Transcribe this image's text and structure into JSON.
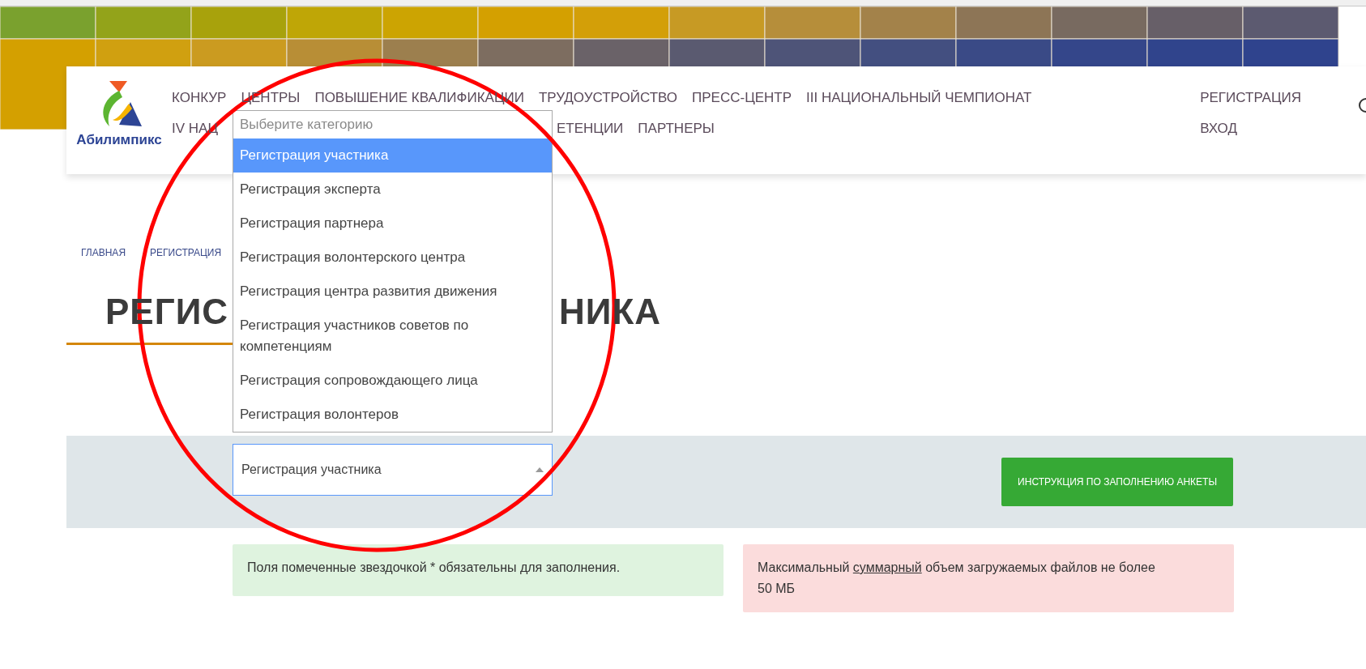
{
  "header": {
    "logo_text": "Абилимпикс",
    "nav_row_1": [
      "КОНКУР",
      "ЦЕНТРЫ",
      "ПОВЫШЕНИЕ КВАЛИФИКАЦИИ",
      "ТРУДОУСТРОЙСТВО",
      "ПРЕСС-ЦЕНТР",
      "III НАЦИОНАЛЬНЫЙ ЧЕМПИОНАТ"
    ],
    "nav_row_2_left": "IV НАЦ",
    "nav_row_2_right": [
      "ЕТЕНЦИИ",
      "ПАРТНЕРЫ"
    ],
    "auth_links": [
      "РЕГИСТРАЦИЯ",
      "ВХОД"
    ]
  },
  "breadcrumbs": [
    "ГЛАВНАЯ",
    "РЕГИСТРАЦИЯ"
  ],
  "title_left": "РЕГИС",
  "title_right": "НИКА",
  "category_select": {
    "value": "Регистрация участника",
    "placeholder": "Выберите категорию",
    "expanded": true,
    "options": [
      {
        "label": "Регистрация участника",
        "selected": true
      },
      {
        "label": "Регистрация эксперта",
        "selected": false
      },
      {
        "label": "Регистрация партнера",
        "selected": false
      },
      {
        "label": "Регистрация волонтерского центра",
        "selected": false
      },
      {
        "label": "Регистрация центра развития движения",
        "selected": false
      },
      {
        "label": "Регистрация участников советов по компетенциям",
        "selected": false
      },
      {
        "label": "Регистрация сопровождающего лица",
        "selected": false
      },
      {
        "label": "Регистрация волонтеров",
        "selected": false
      }
    ]
  },
  "instruction_button": "ИНСТРУКЦИЯ ПО ЗАПОЛНЕНИЮ АНКЕТЫ",
  "alerts": [
    {
      "kind": "success",
      "text": "Поля помеченные звездочкой * обязательны для заполнения."
    },
    {
      "kind": "danger",
      "text": "Максимальный",
      "link": "суммарный",
      "text_after": "объем загружаемых файлов не более 50 МБ"
    }
  ]
}
